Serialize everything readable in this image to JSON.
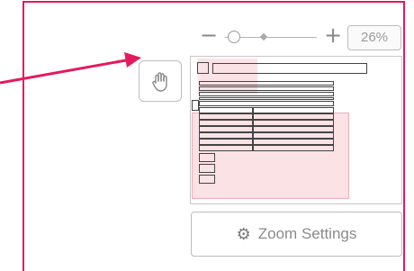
{
  "zoom": {
    "minus_glyph": "−",
    "plus_glyph": "+",
    "level": "26%",
    "slider_value": 0.26
  },
  "tools": {
    "hand_icon": "hand-pan-icon"
  },
  "navigator": {
    "description_icon": "minimap"
  },
  "buttons": {
    "zoom_settings_label": "Zoom Settings",
    "zoom_settings_icon": "gear-icon"
  },
  "colors": {
    "annotation_arrow": "#e5195f",
    "frame": "#e5195f",
    "viewport_highlight": "#f0a0aa"
  }
}
